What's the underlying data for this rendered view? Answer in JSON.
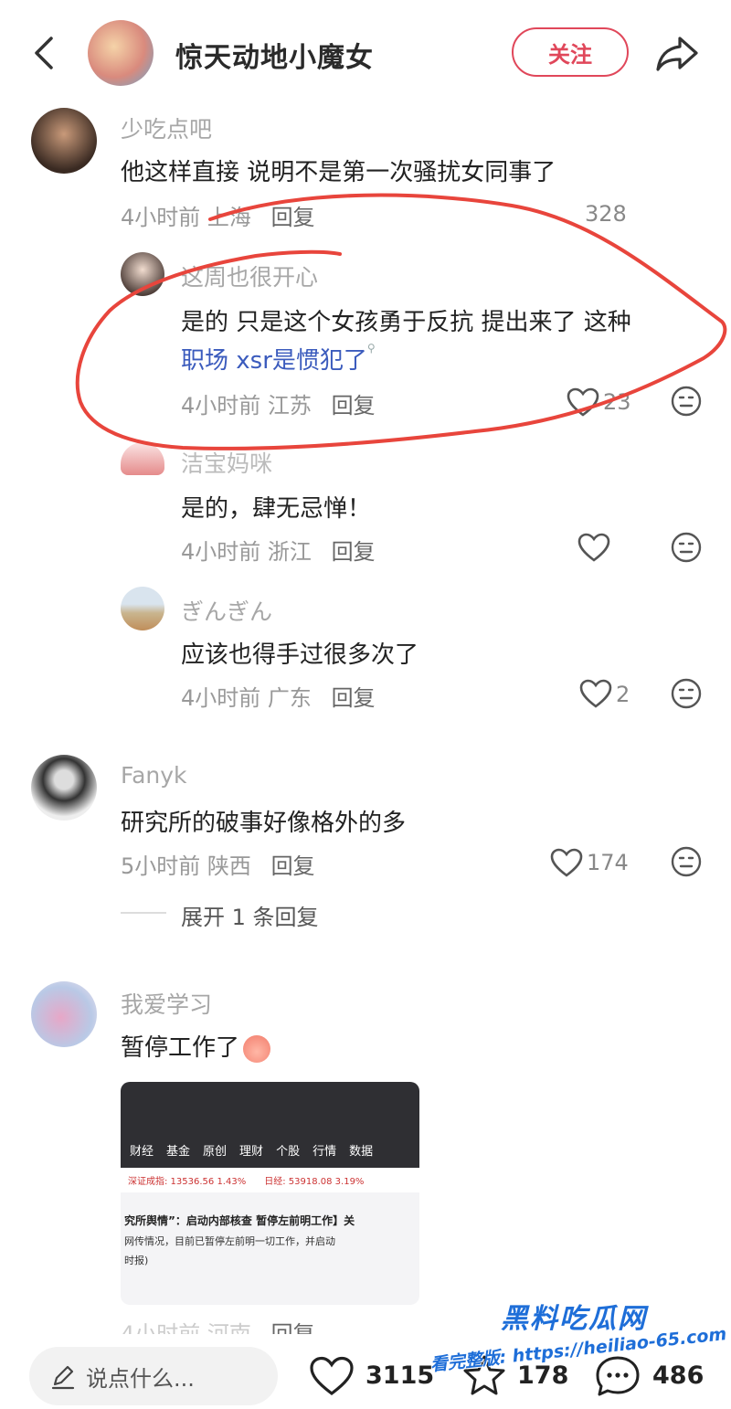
{
  "header": {
    "username": "惊天动地小魔女",
    "follow_label": "关注"
  },
  "comments": [
    {
      "name": "少吃点吧",
      "text": "他这样直接 说明不是第一次骚扰女同事了",
      "time": "4小时前",
      "location": "上海",
      "reply": "回复",
      "likes": "328"
    },
    {
      "name": "这周也很开心",
      "text_line1": "是的 只是这个女孩勇于反抗 提出来了 这种",
      "text_line2_link": "职场 xsr",
      "text_line2": "是惯犯了",
      "time": "4小时前",
      "location": "江苏",
      "reply": "回复",
      "likes": "23"
    },
    {
      "name": "洁宝妈咪",
      "text": "是的，肆无忌惮！",
      "time": "4小时前",
      "location": "浙江",
      "reply": "回复"
    },
    {
      "name": "ぎんぎん",
      "text": "应该也得手过很多次了",
      "time": "4小时前",
      "location": "广东",
      "reply": "回复",
      "likes": "2"
    },
    {
      "name": "Fanyk",
      "text": "研究所的破事好像格外的多",
      "time": "5小时前",
      "location": "陕西",
      "reply": "回复",
      "likes": "174",
      "expand": "展开 1 条回复"
    },
    {
      "name": "我爱学习",
      "text": "暂停工作了",
      "time": "4小时前",
      "location": "河南",
      "reply": "回复"
    }
  ],
  "news_card": {
    "nav": [
      "财经",
      "基金",
      "原创",
      "理财",
      "个股",
      "行情",
      "数据"
    ],
    "index1": "深证成指: 13536.56  1.43%",
    "index2": "日经: 53918.08  3.19%",
    "title": "究所舆情”：启动内部核查 暂停左前明工作】关",
    "body1": "网传情况，目前已暂停左前明一切工作，并启动",
    "body2": "时报)"
  },
  "bottom": {
    "placeholder": "说点什么...",
    "likes": "3115",
    "stars": "178",
    "comments": "486"
  },
  "watermark": {
    "brand": "黑料吃瓜网",
    "url_line": "看完整版: https://heiliao-65.com"
  },
  "colors": {
    "accent": "#e0475a",
    "link": "#3b5bbd",
    "annotation": "#e8453c"
  }
}
